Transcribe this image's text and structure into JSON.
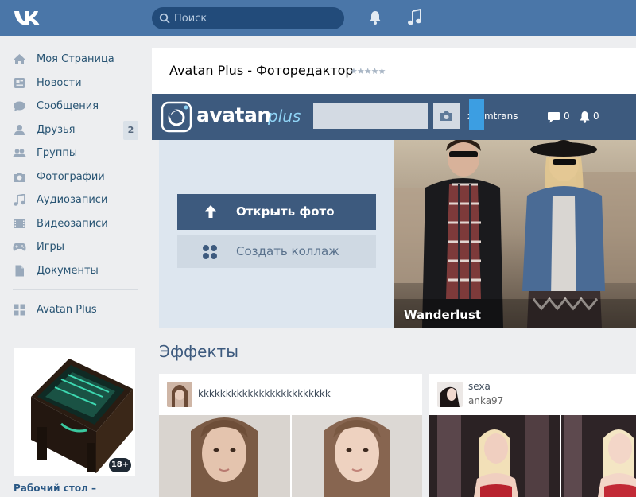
{
  "header": {
    "search_placeholder": "Поиск"
  },
  "sidebar": {
    "items": [
      {
        "label": "Моя Страница",
        "icon": "home-icon"
      },
      {
        "label": "Новости",
        "icon": "news-icon"
      },
      {
        "label": "Сообщения",
        "icon": "messages-icon"
      },
      {
        "label": "Друзья",
        "icon": "friends-icon",
        "badge": "2"
      },
      {
        "label": "Группы",
        "icon": "groups-icon"
      },
      {
        "label": "Фотографии",
        "icon": "camera-icon"
      },
      {
        "label": "Аудиозаписи",
        "icon": "music-note-icon"
      },
      {
        "label": "Видеозаписи",
        "icon": "video-icon"
      },
      {
        "label": "Игры",
        "icon": "gamepad-icon"
      },
      {
        "label": "Документы",
        "icon": "document-icon"
      }
    ],
    "app_item": {
      "label": "Avatan Plus",
      "icon": "apps-grid-icon"
    },
    "ad": {
      "badge": "18+",
      "title": "Рабочий стол –"
    }
  },
  "app": {
    "title": "Avatan Plus - Фоторедактор",
    "rating_stars": "★★★★★",
    "logo_text": "avatan",
    "logo_plus": "plus",
    "username": "zoomtrans",
    "messages_count": "0",
    "notifications_count": "0",
    "open_photo_label": "Открыть фото",
    "create_collage_label": "Создать коллаж",
    "hero_caption": "Wanderlust",
    "effects_title": "Эффекты",
    "cards": [
      {
        "name": "kkkkkkkkkkkkkkkkkkkkkkkk"
      },
      {
        "name": "sexa",
        "sub": "anka97"
      }
    ]
  },
  "colors": {
    "header_bg": "#4a76a8",
    "avatan_bar": "#3d5a7e",
    "accent_blue": "#3c9ee2",
    "link": "#285473"
  }
}
